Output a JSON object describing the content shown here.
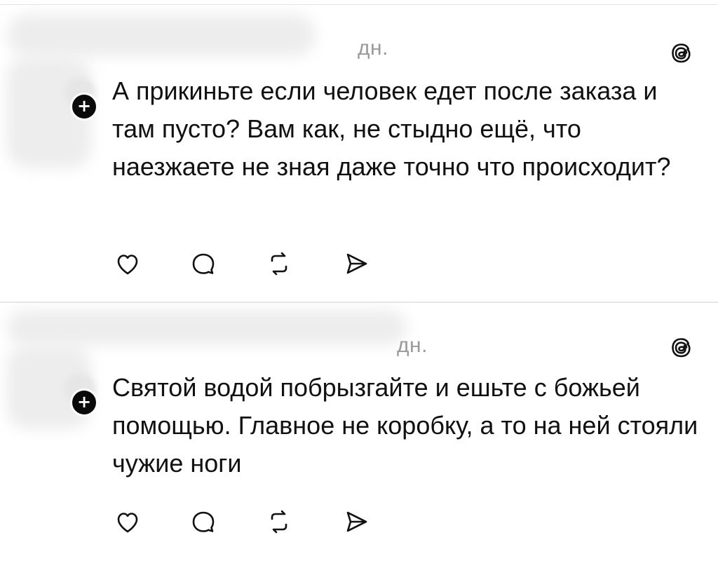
{
  "posts": [
    {
      "timestamp": "дн.",
      "text": "А прикиньте если человек едет после заказа и там пусто? Вам как, не стыдно ещё, что наезжаете не зная даже точно что происходит?",
      "follow_badge": "+",
      "icons": [
        "heart-icon",
        "comment-icon",
        "repost-icon",
        "share-icon",
        "threads-logo-icon"
      ]
    },
    {
      "timestamp": "дн.",
      "text": "Святой водой побрызгайте и ешьте с божьей помощью. Главное не коробку, а то на ней стояли чужие ноги",
      "follow_badge": "+",
      "icons": [
        "heart-icon",
        "comment-icon",
        "repost-icon",
        "share-icon",
        "threads-logo-icon"
      ]
    }
  ],
  "colors": {
    "text": "#111111",
    "timestamp": "#9a9a9a",
    "divider": "#e6e6e6",
    "badge": "#0a0a0a"
  }
}
